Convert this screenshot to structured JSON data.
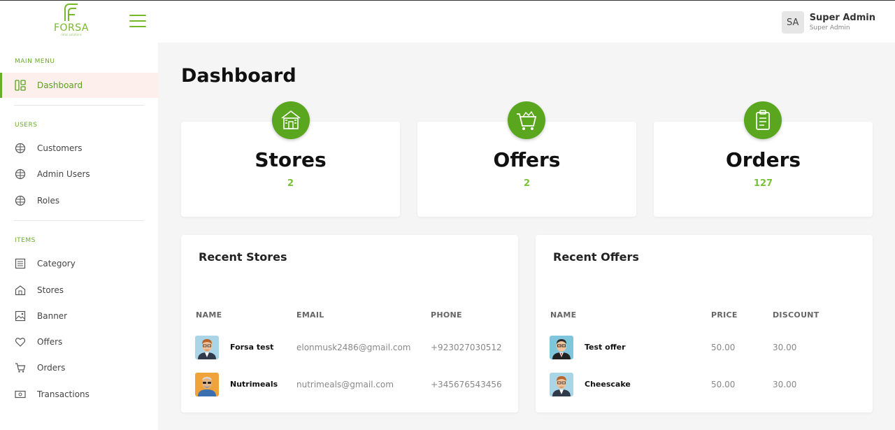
{
  "brand": {
    "name": "FORSA",
    "tagline": "retail solutions",
    "color": "#76b82a"
  },
  "header": {
    "user": {
      "initials": "SA",
      "name": "Super Admin",
      "role": "Super Admin"
    }
  },
  "sidebar": {
    "sections": [
      {
        "title": "MAIN MENU"
      },
      {
        "title": "USERS"
      },
      {
        "title": "ITEMS"
      }
    ],
    "items": [
      {
        "label": "Dashboard",
        "icon": "dashboard-icon",
        "active": true
      },
      {
        "label": "Customers",
        "icon": "globe-icon"
      },
      {
        "label": "Admin Users",
        "icon": "globe-icon"
      },
      {
        "label": "Roles",
        "icon": "globe-icon"
      },
      {
        "label": "Category",
        "icon": "list-icon"
      },
      {
        "label": "Stores",
        "icon": "store-icon"
      },
      {
        "label": "Banner",
        "icon": "image-icon"
      },
      {
        "label": "Offers",
        "icon": "heart-icon"
      },
      {
        "label": "Orders",
        "icon": "cart-icon"
      },
      {
        "label": "Transactions",
        "icon": "money-icon"
      }
    ]
  },
  "main": {
    "title": "Dashboard",
    "stats": [
      {
        "label": "Stores",
        "value": "2",
        "icon": "store-icon"
      },
      {
        "label": "Offers",
        "value": "2",
        "icon": "cart-icon"
      },
      {
        "label": "Orders",
        "value": "127",
        "icon": "clipboard-icon"
      }
    ],
    "recent_stores": {
      "title": "Recent Stores",
      "columns": [
        "NAME",
        "EMAIL",
        "PHONE"
      ],
      "rows": [
        {
          "name": "Forsa test",
          "email": "elonmusk2486@gmail.com",
          "phone": "+923027030512"
        },
        {
          "name": "Nutrimeals",
          "email": "nutrimeals@gmail.com",
          "phone": "+345676543456"
        }
      ]
    },
    "recent_offers": {
      "title": "Recent Offers",
      "columns": [
        "NAME",
        "PRICE",
        "DISCOUNT"
      ],
      "rows": [
        {
          "name": "Test offer",
          "price": "50.00",
          "discount": "30.00"
        },
        {
          "name": "Cheescake",
          "price": "50.00",
          "discount": "30.00"
        }
      ]
    }
  }
}
